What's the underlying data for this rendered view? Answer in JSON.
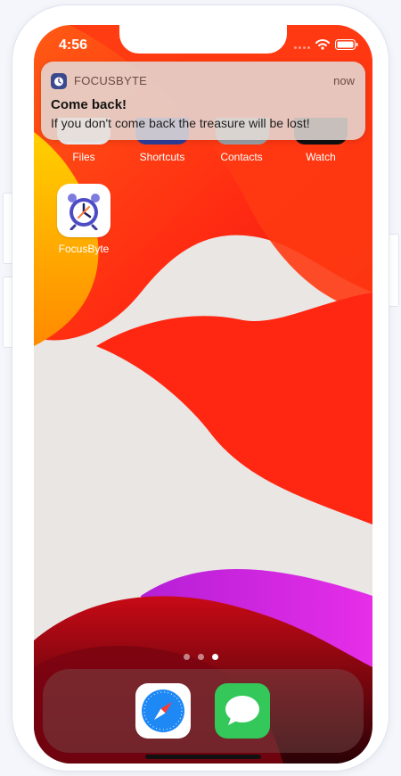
{
  "status_bar": {
    "time": "4:56"
  },
  "notification": {
    "app_name": "FOCUSBYTE",
    "time": "now",
    "title": "Come back!",
    "body": "If you don't come back the treasure will be lost!"
  },
  "apps": {
    "row1": [
      {
        "label": "Files"
      },
      {
        "label": "Shortcuts"
      },
      {
        "label": "Contacts"
      },
      {
        "label": "Watch"
      }
    ],
    "focusbyte": {
      "label": "FocusByte"
    }
  },
  "page_dots": {
    "count": 3,
    "active": 3
  },
  "dock": [
    {
      "name": "Safari",
      "icon": "safari-icon",
      "color": "#1e88f5"
    },
    {
      "name": "Messages",
      "icon": "messages-icon",
      "color": "#34c759"
    }
  ],
  "colors": {
    "accent": "#ff2d10",
    "notification_app": "#3b4a8e"
  }
}
